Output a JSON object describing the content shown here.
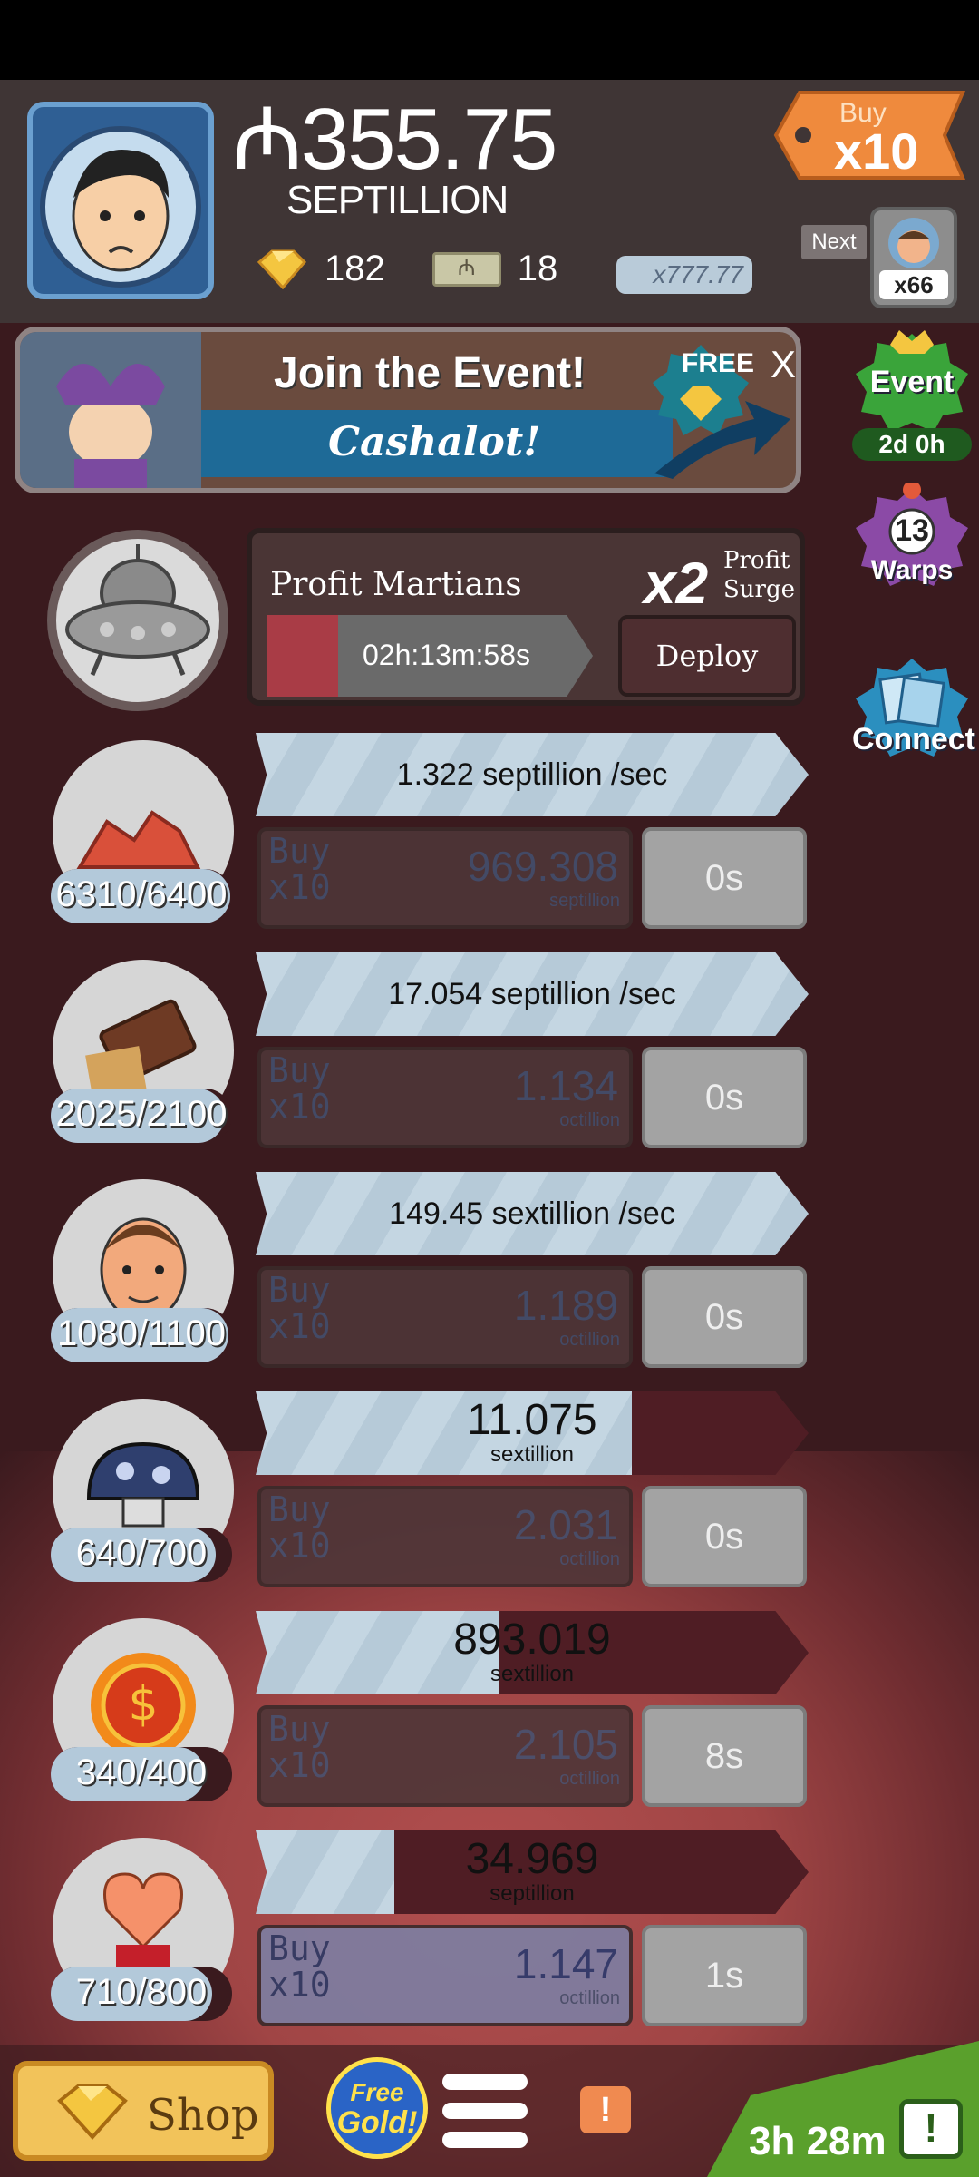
{
  "header": {
    "cash_amount": "₼355.75",
    "cash_unit": "SEPTILLION",
    "gold_count": "182",
    "megabucks_count": "18",
    "exchange_label": "x777.77",
    "buy_multiplier": {
      "small": "Buy",
      "big": "x10"
    },
    "next_label": "Next",
    "next_count": "x66"
  },
  "event_banner": {
    "title": "Join the Event!",
    "subtitle": "Cashalot!",
    "free_label": "FREE",
    "close": "X"
  },
  "side_buttons": [
    {
      "label": "Event",
      "sub": "2d 0h"
    },
    {
      "label": "Warps",
      "badge": "13"
    },
    {
      "label": "Connect"
    }
  ],
  "profit_martians": {
    "title": "Profit Martians",
    "multiplier": "x2",
    "surge_line1": "Profit",
    "surge_line2": "Surge",
    "timer": "02h:13m:58s",
    "timer_progress": 0.22,
    "deploy_label": "Deploy"
  },
  "businesses": [
    {
      "owned": "6310/6400",
      "owned_progress": 0.99,
      "revenue": "1.322 septillion /sec",
      "revenue_big": "",
      "revenue_unit": "",
      "progress": 1.0,
      "buy_line1": "Buy",
      "buy_line2": "x10",
      "price": "969.308",
      "price_unit": "septillion",
      "time": "0s",
      "active": false,
      "icon": "red-ore-icon"
    },
    {
      "owned": "2025/2100",
      "owned_progress": 0.96,
      "revenue": "17.054 septillion /sec",
      "revenue_big": "",
      "revenue_unit": "",
      "progress": 1.0,
      "buy_line1": "Buy",
      "buy_line2": "x10",
      "price": "1.134",
      "price_unit": "octillion",
      "time": "0s",
      "active": false,
      "icon": "chocolate-bar-icon"
    },
    {
      "owned": "1080/1100",
      "owned_progress": 0.98,
      "revenue": "149.45 sextillion /sec",
      "revenue_big": "",
      "revenue_unit": "",
      "progress": 1.0,
      "buy_line1": "Buy",
      "buy_line2": "x10",
      "price": "1.189",
      "price_unit": "octillion",
      "time": "0s",
      "active": false,
      "icon": "man-face-icon"
    },
    {
      "owned": "640/700",
      "owned_progress": 0.91,
      "revenue": "",
      "revenue_big": "11.075",
      "revenue_unit": "sextillion",
      "progress": 0.68,
      "buy_line1": "Buy",
      "buy_line2": "x10",
      "price": "2.031",
      "price_unit": "octillion",
      "time": "0s",
      "active": false,
      "icon": "mushroom-icon"
    },
    {
      "owned": "340/400",
      "owned_progress": 0.85,
      "revenue": "",
      "revenue_big": "893.019",
      "revenue_unit": "sextillion",
      "progress": 0.44,
      "buy_line1": "Buy",
      "buy_line2": "x10",
      "price": "2.105",
      "price_unit": "octillion",
      "time": "8s",
      "active": false,
      "icon": "sun-coin-icon"
    },
    {
      "owned": "710/800",
      "owned_progress": 0.89,
      "revenue": "",
      "revenue_big": "34.969",
      "revenue_unit": "septillion",
      "progress": 0.25,
      "buy_line1": "Buy",
      "buy_line2": "x10",
      "price": "1.147",
      "price_unit": "octillion",
      "time": "1s",
      "active": true,
      "icon": "heart-creature-icon"
    }
  ],
  "bottom_bar": {
    "shop_label": "Shop",
    "free_gold_line1": "Free",
    "free_gold_line2": "Gold!",
    "alert": "!",
    "tv_timer": "3h 28m",
    "tv_alert": "!"
  }
}
